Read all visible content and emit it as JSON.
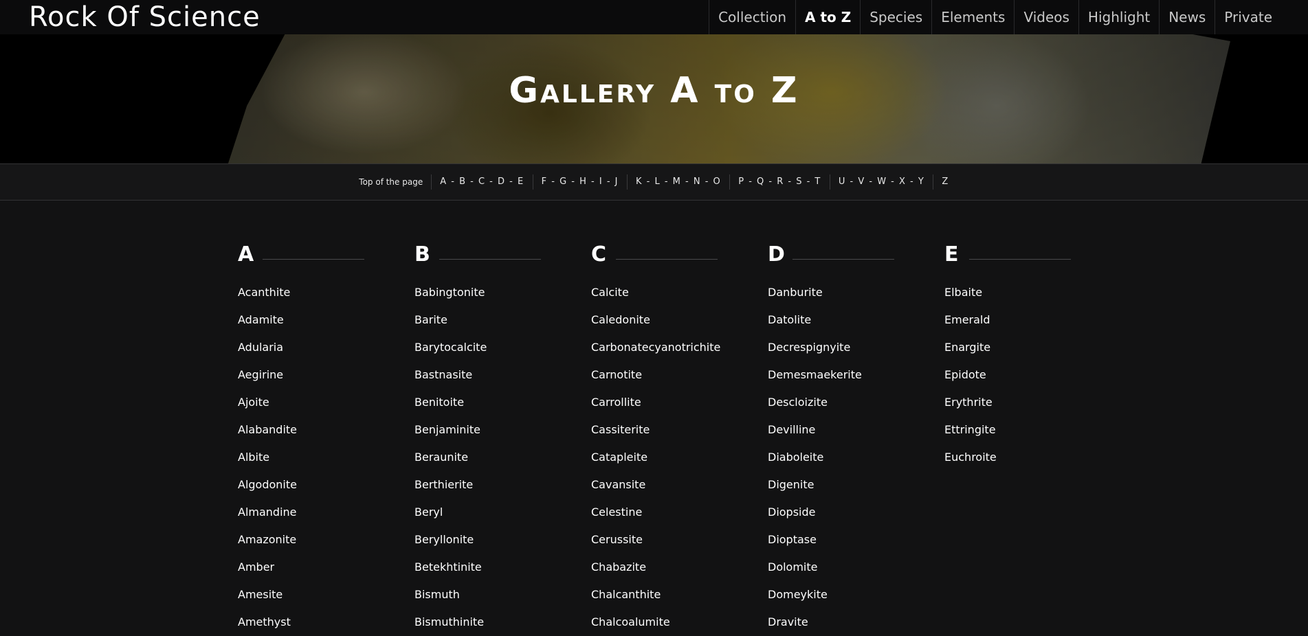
{
  "site": {
    "brand": "Rock Of Science"
  },
  "nav": {
    "items": [
      {
        "label": "Collection",
        "active": false
      },
      {
        "label": "A to Z",
        "active": true
      },
      {
        "label": "Species",
        "active": false
      },
      {
        "label": "Elements",
        "active": false
      },
      {
        "label": "Videos",
        "active": false
      },
      {
        "label": "Highlight",
        "active": false
      },
      {
        "label": "News",
        "active": false
      },
      {
        "label": "Private",
        "active": false
      }
    ]
  },
  "hero": {
    "title": "Gallery A to Z"
  },
  "strip": {
    "items": [
      "Top of the page",
      "A - B - C - D - E",
      "F - G - H - I - J",
      "K - L - M - N - O",
      "P - Q - R - S - T",
      "U - V - W - X - Y",
      "Z"
    ]
  },
  "columns": [
    {
      "letter": "A",
      "items": [
        "Acanthite",
        "Adamite",
        "Adularia",
        "Aegirine",
        "Ajoite",
        "Alabandite",
        "Albite",
        "Algodonite",
        "Almandine",
        "Amazonite",
        "Amber",
        "Amesite",
        "Amethyst"
      ]
    },
    {
      "letter": "B",
      "items": [
        "Babingtonite",
        "Barite",
        "Barytocalcite",
        "Bastnasite",
        "Benitoite",
        "Benjaminite",
        "Beraunite",
        "Berthierite",
        "Beryl",
        "Beryllonite",
        "Betekhtinite",
        "Bismuth",
        "Bismuthinite"
      ]
    },
    {
      "letter": "C",
      "items": [
        "Calcite",
        "Caledonite",
        "Carbonatecyanotrichite",
        "Carnotite",
        "Carrollite",
        "Cassiterite",
        "Catapleite",
        "Cavansite",
        "Celestine",
        "Cerussite",
        "Chabazite",
        "Chalcanthite",
        "Chalcoalumite"
      ]
    },
    {
      "letter": "D",
      "items": [
        "Danburite",
        "Datolite",
        "Decrespignyite",
        "Demesmaekerite",
        "Descloizite",
        "Devilline",
        "Diaboleite",
        "Digenite",
        "Diopside",
        "Dioptase",
        "Dolomite",
        "Domeykite",
        "Dravite"
      ]
    },
    {
      "letter": "E",
      "items": [
        "Elbaite",
        "Emerald",
        "Enargite",
        "Epidote",
        "Erythrite",
        "Ettringite",
        "Euchroite"
      ]
    }
  ]
}
